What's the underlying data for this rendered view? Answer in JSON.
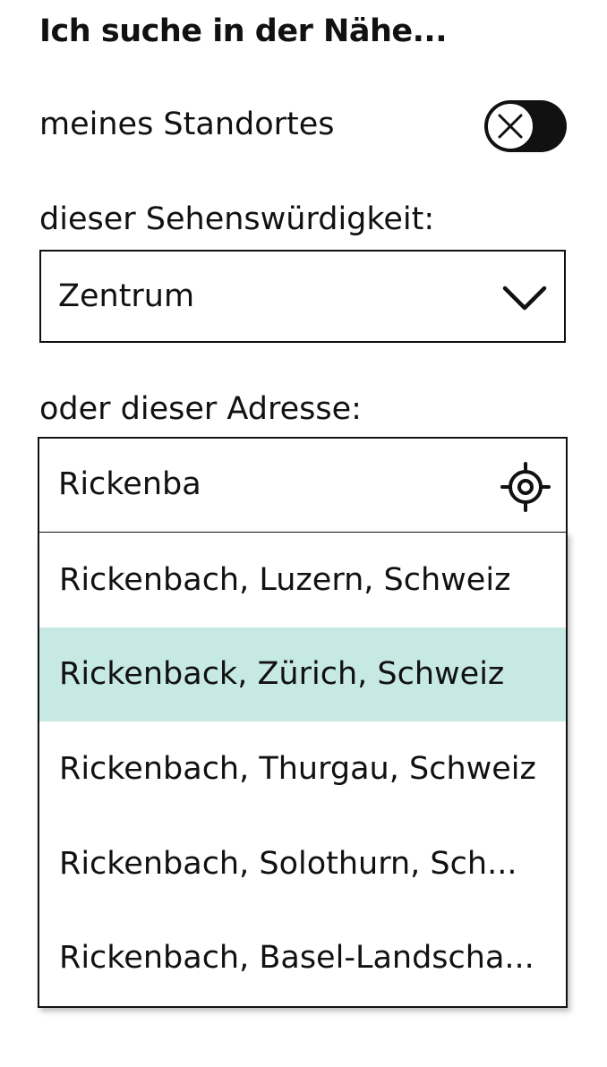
{
  "heading": "Ich suche in der Nähe...",
  "location": {
    "label": "meines Standortes",
    "toggle_icon": "close-x-icon",
    "enabled": false
  },
  "sight": {
    "label": "dieser Sehenswürdigkeit:",
    "selected": "Zentrum",
    "chevron_icon": "chevron-down-icon"
  },
  "address": {
    "label": "oder dieser Adresse:",
    "value": "Rickenba",
    "locate_icon": "locate-target-icon"
  },
  "suggestions": [
    {
      "text": "Rickenbach, Luzern, Schweiz",
      "highlighted": false
    },
    {
      "text": "Rickenback, Zürich, Schweiz",
      "highlighted": true
    },
    {
      "text": "Rickenbach, Thurgau, Schweiz",
      "highlighted": false
    },
    {
      "text": "Rickenbach, Solothurn, Sch...",
      "highlighted": false
    },
    {
      "text": "Rickenbach, Basel-Landscha...",
      "highlighted": false
    }
  ],
  "colors": {
    "text": "#111111",
    "highlight": "#c7e9e3",
    "toggle_off": "#111111"
  }
}
